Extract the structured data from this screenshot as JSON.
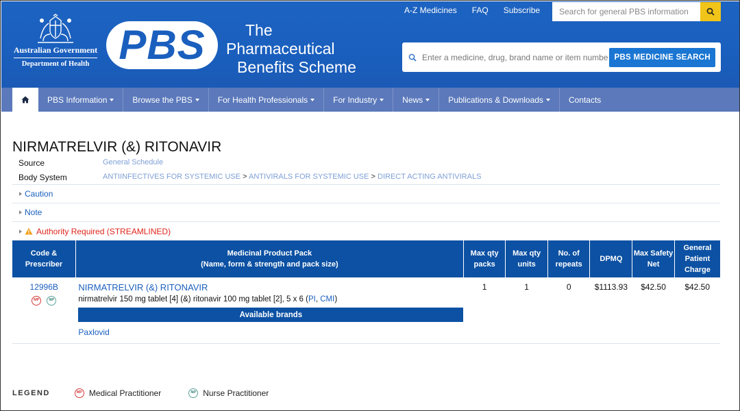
{
  "header": {
    "gov_line1": "Australian Government",
    "gov_line2": "Department of Health",
    "logo_text": "PBS",
    "subtitle_1": "The",
    "subtitle_2": "Pharmaceutical",
    "subtitle_3": "Benefits Scheme",
    "top_links": [
      "A-Z Medicines",
      "FAQ",
      "Subscribe"
    ],
    "top_search_placeholder": "Search for general PBS information",
    "med_search_placeholder": "Enter a medicine, drug, brand name or item number",
    "med_search_button": "PBS MEDICINE SEARCH"
  },
  "nav": {
    "items": [
      "PBS Information",
      "Browse the PBS",
      "For Health Professionals",
      "For Industry",
      "News",
      "Publications & Downloads",
      "Contacts"
    ]
  },
  "medicine": {
    "title": "NIRMATRELVIR (&) RITONAVIR",
    "source_label": "Source",
    "source_value": "General Schedule",
    "body_label": "Body System",
    "body_path": [
      "ANTIINFECTIVES FOR SYSTEMIC USE",
      "ANTIVIRALS FOR SYSTEMIC USE",
      "DIRECT ACTING ANTIVIRALS"
    ],
    "separator": ">",
    "sections": [
      "Caution",
      "Note",
      "Authority Required (STREAMLINED)"
    ]
  },
  "table": {
    "headers": {
      "code_1": "Code &",
      "code_2": "Prescriber",
      "pack_1": "Medicinal Product Pack",
      "pack_2": "(Name, form & strength and pack size)",
      "maxpacks_1": "Max qty",
      "maxpacks_2": "packs",
      "maxunits_1": "Max qty",
      "maxunits_2": "units",
      "repeats_1": "No. of",
      "repeats_2": "repeats",
      "dpmq": "DPMQ",
      "safety_1": "Max Safety",
      "safety_2": "Net",
      "charge_1": "General",
      "charge_2": "Patient",
      "charge_3": "Charge"
    },
    "row": {
      "code": "12996B",
      "mp": "MP",
      "np": "NP",
      "name": "NIRMATRELVIR (&) RITONAVIR",
      "desc": "nirmatrelvir 150 mg tablet [4] (&) ritonavir 100 mg tablet [2], 5 x 6 (",
      "pi": "PI",
      "comma": ", ",
      "cmi": "CMI",
      "close": ")",
      "max_packs": "1",
      "max_units": "1",
      "repeats": "0",
      "dpmq": "$1113.93",
      "safety_net": "$42.50",
      "patient_charge": "$42.50",
      "brands_header": "Available brands",
      "brand": "Paxlovid"
    }
  },
  "legend": {
    "label": "LEGEND",
    "mp": "MP",
    "mp_text": "Medical Practitioner",
    "np": "NP",
    "np_text": "Nurse Practitioner"
  },
  "colors": {
    "header_blue": "#1a5fbe",
    "nav_blue": "#5b79bb",
    "table_blue": "#0c51a3",
    "search_yellow": "#f0c419",
    "authority_red": "#e0241b"
  }
}
